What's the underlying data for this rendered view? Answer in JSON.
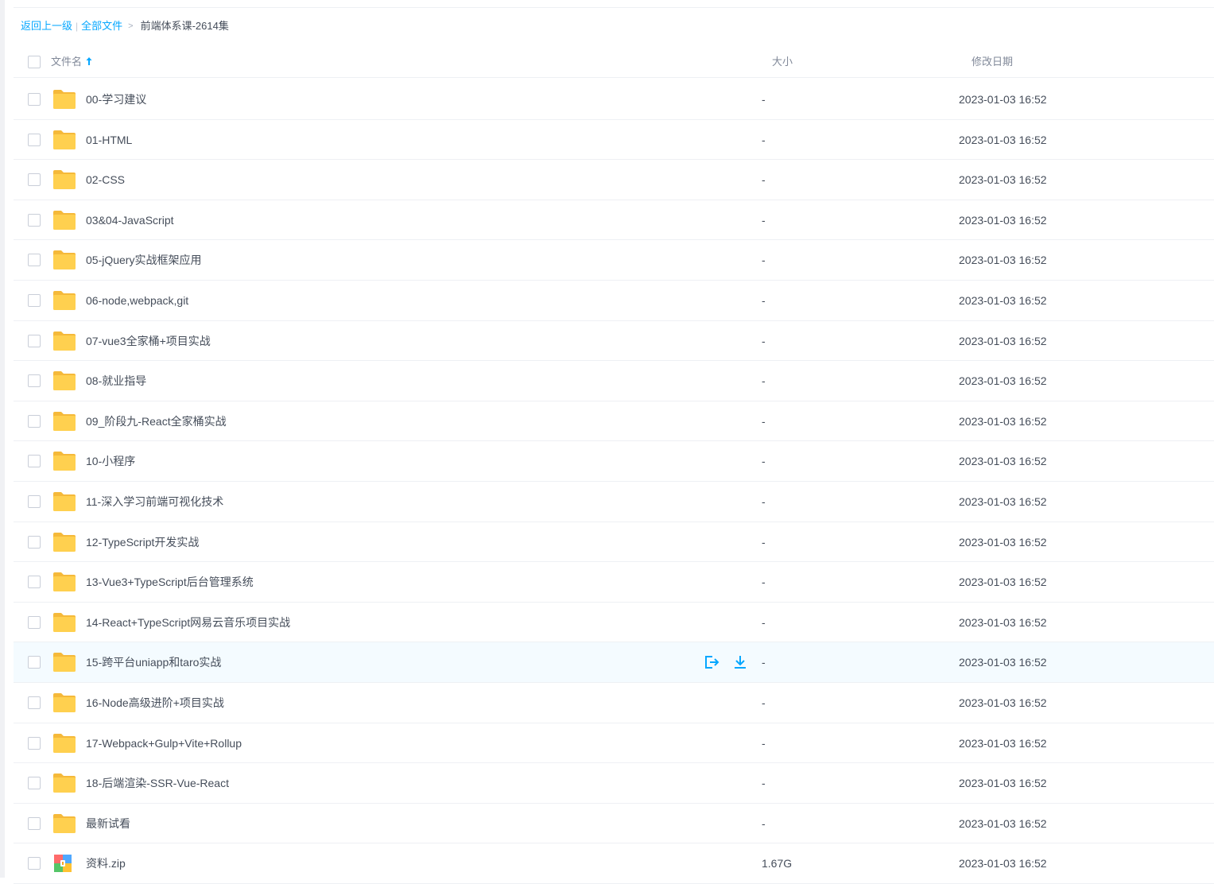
{
  "breadcrumb": {
    "back": "返回上一级",
    "sep": "|",
    "all_files": "全部文件",
    "chevron": ">",
    "current": "前端体系课-2614集"
  },
  "columns": {
    "name": "文件名",
    "size": "大小",
    "date": "修改日期"
  },
  "colors": {
    "accent": "#06a7ff",
    "folder": "#ffd04f",
    "hover_row": "#f4fbff"
  },
  "rows": [
    {
      "name": "00-学习建议",
      "size": "-",
      "date": "2023-01-03 16:52",
      "icon": "folder-icon"
    },
    {
      "name": "01-HTML",
      "size": "-",
      "date": "2023-01-03 16:52",
      "icon": "folder-icon"
    },
    {
      "name": "02-CSS",
      "size": "-",
      "date": "2023-01-03 16:52",
      "icon": "folder-icon"
    },
    {
      "name": "03&04-JavaScript",
      "size": "-",
      "date": "2023-01-03 16:52",
      "icon": "folder-icon"
    },
    {
      "name": "05-jQuery实战框架应用",
      "size": "-",
      "date": "2023-01-03 16:52",
      "icon": "folder-icon"
    },
    {
      "name": "06-node,webpack,git",
      "size": "-",
      "date": "2023-01-03 16:52",
      "icon": "folder-icon"
    },
    {
      "name": "07-vue3全家桶+项目实战",
      "size": "-",
      "date": "2023-01-03 16:52",
      "icon": "folder-icon"
    },
    {
      "name": "08-就业指导",
      "size": "-",
      "date": "2023-01-03 16:52",
      "icon": "folder-icon"
    },
    {
      "name": "09_阶段九-React全家桶实战",
      "size": "-",
      "date": "2023-01-03 16:52",
      "icon": "folder-icon"
    },
    {
      "name": "10-小程序",
      "size": "-",
      "date": "2023-01-03 16:52",
      "icon": "folder-icon"
    },
    {
      "name": "11-深入学习前端可视化技术",
      "size": "-",
      "date": "2023-01-03 16:52",
      "icon": "folder-icon"
    },
    {
      "name": "12-TypeScript开发实战",
      "size": "-",
      "date": "2023-01-03 16:52",
      "icon": "folder-icon"
    },
    {
      "name": "13-Vue3+TypeScript后台管理系统",
      "size": "-",
      "date": "2023-01-03 16:52",
      "icon": "folder-icon"
    },
    {
      "name": "14-React+TypeScript网易云音乐项目实战",
      "size": "-",
      "date": "2023-01-03 16:52",
      "icon": "folder-icon"
    },
    {
      "name": "15-跨平台uniapp和taro实战",
      "size": "-",
      "date": "2023-01-03 16:52",
      "icon": "folder-icon",
      "hover": true
    },
    {
      "name": "16-Node高级进阶+项目实战",
      "size": "-",
      "date": "2023-01-03 16:52",
      "icon": "folder-icon"
    },
    {
      "name": "17-Webpack+Gulp+Vite+Rollup",
      "size": "-",
      "date": "2023-01-03 16:52",
      "icon": "folder-icon"
    },
    {
      "name": "18-后端渲染-SSR-Vue-React",
      "size": "-",
      "date": "2023-01-03 16:52",
      "icon": "folder-icon"
    },
    {
      "name": "最新试看",
      "size": "-",
      "date": "2023-01-03 16:52",
      "icon": "folder-icon"
    },
    {
      "name": "资料.zip",
      "size": "1.67G",
      "date": "2023-01-03 16:52",
      "icon": "zip-file-icon"
    }
  ]
}
